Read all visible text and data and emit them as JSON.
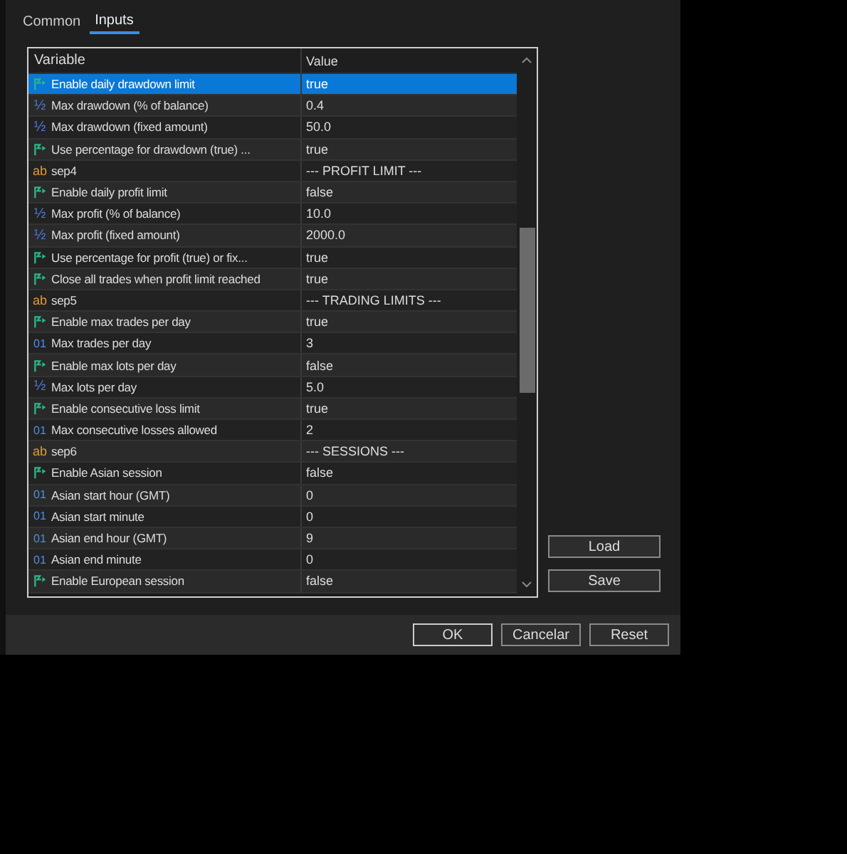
{
  "tabs": [
    {
      "label": "Common",
      "selected": false
    },
    {
      "label": "Inputs",
      "selected": true
    }
  ],
  "table": {
    "columns": [
      "Variable",
      "Value"
    ],
    "rows": [
      {
        "kind": "bool",
        "variable": "Enable daily drawdown limit",
        "value": "true",
        "selected": true
      },
      {
        "kind": "double",
        "icon": "½",
        "variable": "Max drawdown (% of balance)",
        "value": "0.4",
        "selected": false
      },
      {
        "kind": "double",
        "icon": "½",
        "variable": "Max drawdown (fixed amount)",
        "value": "50.0",
        "selected": false
      },
      {
        "kind": "bool",
        "variable": "Use percentage for drawdown (true) ...",
        "value": "true",
        "selected": false
      },
      {
        "kind": "string",
        "icon": "ab",
        "variable": "sep4",
        "value": "--- PROFIT LIMIT ---",
        "selected": false
      },
      {
        "kind": "bool",
        "variable": "Enable daily profit limit",
        "value": "false",
        "selected": false
      },
      {
        "kind": "double",
        "icon": "½",
        "variable": "Max profit (% of balance)",
        "value": "10.0",
        "selected": false
      },
      {
        "kind": "double",
        "icon": "½",
        "variable": "Max profit (fixed amount)",
        "value": "2000.0",
        "selected": false
      },
      {
        "kind": "bool",
        "variable": "Use percentage for profit (true) or fix...",
        "value": "true",
        "selected": false
      },
      {
        "kind": "bool",
        "variable": "Close all trades when profit limit reached",
        "value": "true",
        "selected": false
      },
      {
        "kind": "string",
        "icon": "ab",
        "variable": "sep5",
        "value": "--- TRADING LIMITS ---",
        "selected": false
      },
      {
        "kind": "bool",
        "variable": "Enable max trades per day",
        "value": "true",
        "selected": false
      },
      {
        "kind": "int",
        "icon": "01",
        "variable": "Max trades per day",
        "value": "3",
        "selected": false
      },
      {
        "kind": "bool",
        "variable": "Enable max lots per day",
        "value": "false",
        "selected": false
      },
      {
        "kind": "double",
        "icon": "½",
        "variable": "Max lots per day",
        "value": "5.0",
        "selected": false
      },
      {
        "kind": "bool",
        "variable": "Enable consecutive loss limit",
        "value": "true",
        "selected": false
      },
      {
        "kind": "int",
        "icon": "01",
        "variable": "Max consecutive losses allowed",
        "value": "2",
        "selected": false
      },
      {
        "kind": "string",
        "icon": "ab",
        "variable": "sep6",
        "value": "--- SESSIONS ---",
        "selected": false
      },
      {
        "kind": "bool",
        "variable": "Enable Asian session",
        "value": "false",
        "selected": false
      },
      {
        "kind": "int",
        "icon": "01",
        "variable": "Asian start hour (GMT)",
        "value": "0",
        "selected": false
      },
      {
        "kind": "int",
        "icon": "01",
        "variable": "Asian start minute",
        "value": "0",
        "selected": false
      },
      {
        "kind": "int",
        "icon": "01",
        "variable": "Asian end hour (GMT)",
        "value": "9",
        "selected": false
      },
      {
        "kind": "int",
        "icon": "01",
        "variable": "Asian end minute",
        "value": "0",
        "selected": false
      },
      {
        "kind": "bool",
        "variable": "Enable European session",
        "value": "false",
        "selected": false
      }
    ]
  },
  "side_buttons": [
    "Load",
    "Save"
  ],
  "buttons": [
    "OK",
    "Cancelar",
    "Reset"
  ]
}
